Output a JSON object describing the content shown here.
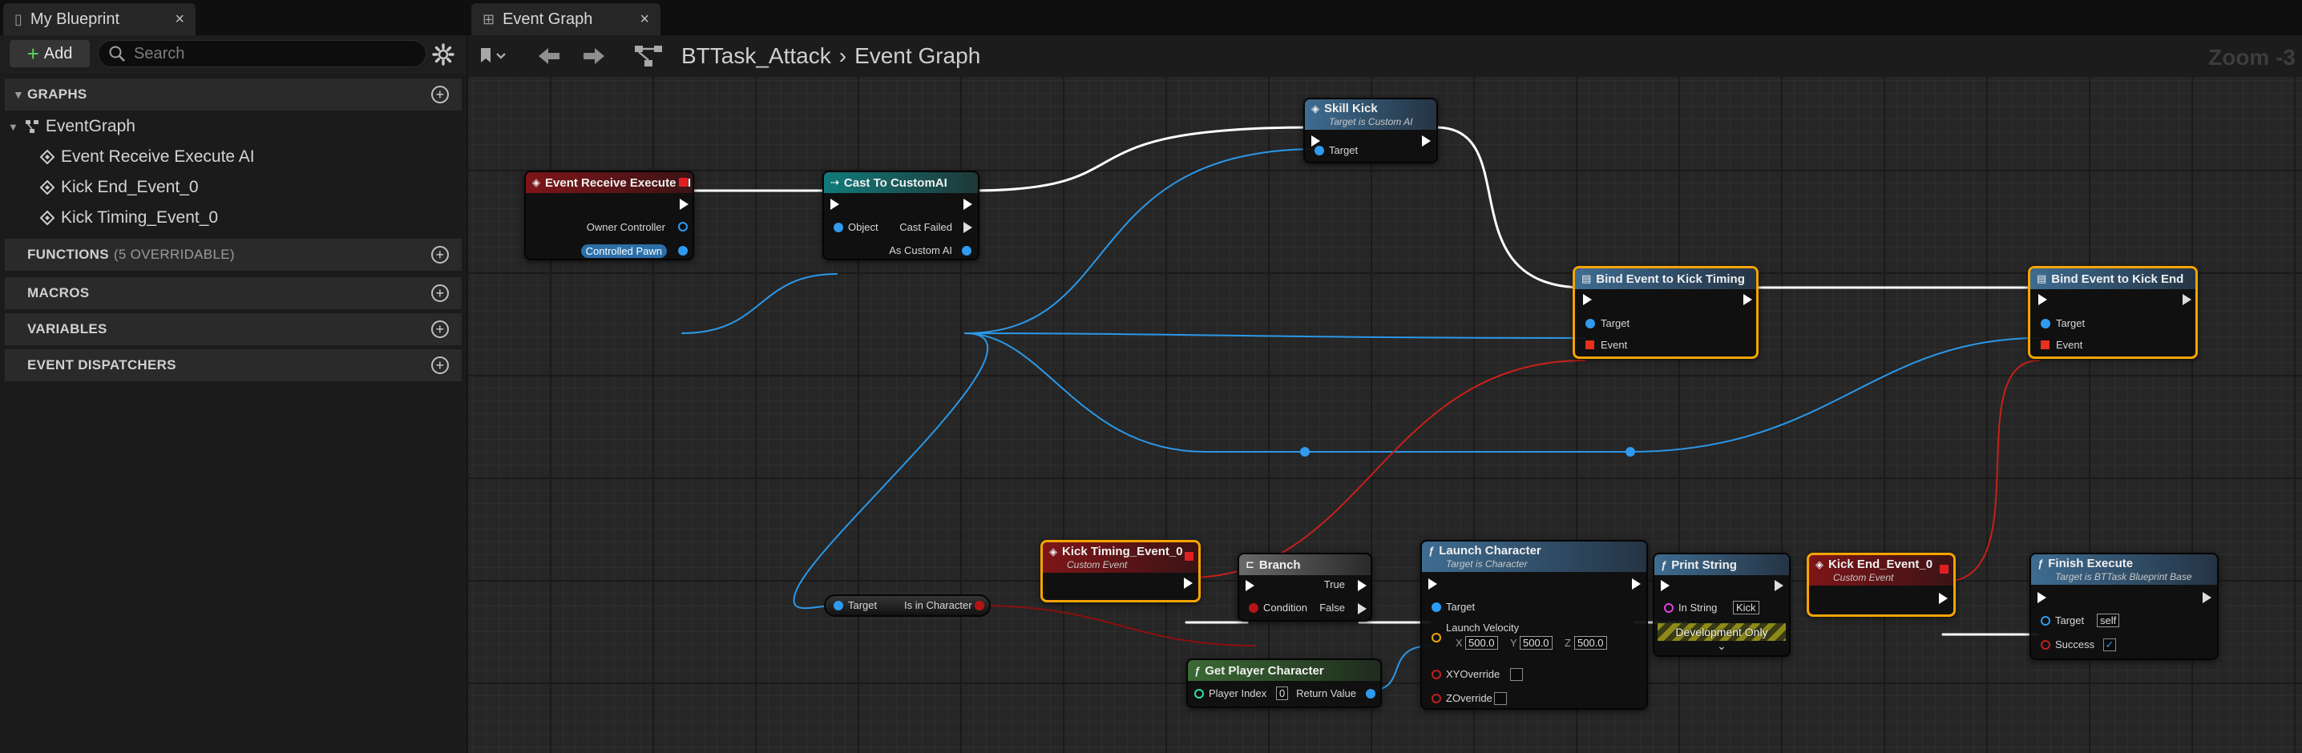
{
  "left_tab": {
    "label": "My Blueprint",
    "close": "×"
  },
  "graph_tab": {
    "label": "Event Graph",
    "close": "×"
  },
  "my_blueprint": {
    "add_label": "Add",
    "search_placeholder": "Search",
    "sections": {
      "graphs": {
        "label": "GRAPHS"
      },
      "functions": {
        "label": "FUNCTIONS",
        "sub": "(5 OVERRIDABLE)"
      },
      "macros": {
        "label": "MACROS"
      },
      "variables": {
        "label": "VARIABLES"
      },
      "dispatchers": {
        "label": "EVENT DISPATCHERS"
      }
    },
    "graph_root": "EventGraph",
    "graph_items": [
      {
        "label": "Event Receive Execute AI"
      },
      {
        "label": "Kick End_Event_0"
      },
      {
        "label": "Kick Timing_Event_0"
      }
    ]
  },
  "graph_toolbar": {
    "breadcrumb_asset": "BTTask_Attack",
    "breadcrumb_sep": "›",
    "breadcrumb_graph": "Event Graph",
    "zoom": "Zoom -3"
  },
  "nodes": {
    "receive_execute": {
      "title": "Event Receive Execute AI",
      "pins": {
        "owner": "Owner Controller",
        "pawn": "Controlled Pawn"
      }
    },
    "cast": {
      "title": "Cast To CustomAI",
      "pins": {
        "object": "Object",
        "failed": "Cast Failed",
        "as": "As Custom AI"
      }
    },
    "skill_kick": {
      "title": "Skill Kick",
      "subtitle": "Target is Custom AI",
      "pins": {
        "target": "Target"
      }
    },
    "bind_timing": {
      "title": "Bind Event to Kick Timing",
      "pins": {
        "target": "Target",
        "event": "Event"
      }
    },
    "bind_end": {
      "title": "Bind Event to Kick End",
      "pins": {
        "target": "Target",
        "event": "Event"
      }
    },
    "is_in_character": {
      "pins": {
        "target": "Target",
        "out": "Is in Character"
      }
    },
    "kick_timing_event": {
      "title": "Kick Timing_Event_0",
      "subtitle": "Custom Event"
    },
    "branch": {
      "title": "Branch",
      "pins": {
        "condition": "Condition",
        "true": "True",
        "false": "False"
      }
    },
    "launch": {
      "title": "Launch Character",
      "subtitle": "Target is Character",
      "pins": {
        "target": "Target",
        "velocity": "Launch Velocity",
        "xy": "XYOverride",
        "z": "ZOverride"
      },
      "velocity": {
        "x_label": "X",
        "x": "500.0",
        "y_label": "Y",
        "y": "500.0",
        "z_label": "Z",
        "z": "500.0"
      }
    },
    "print": {
      "title": "Print String",
      "pins": {
        "in": "In String"
      },
      "in_value": "Kick",
      "dev_only": "Development Only",
      "expand": "⌄"
    },
    "kick_end_event": {
      "title": "Kick End_Event_0",
      "subtitle": "Custom Event"
    },
    "finish": {
      "title": "Finish Execute",
      "subtitle": "Target is BTTask Blueprint Base",
      "pins": {
        "target": "Target",
        "success": "Success"
      },
      "target_value": "self",
      "success_value": "✓"
    },
    "get_player": {
      "title": "Get Player Character",
      "pins": {
        "index": "Player Index",
        "ret": "Return Value"
      },
      "index_value": "0"
    }
  }
}
